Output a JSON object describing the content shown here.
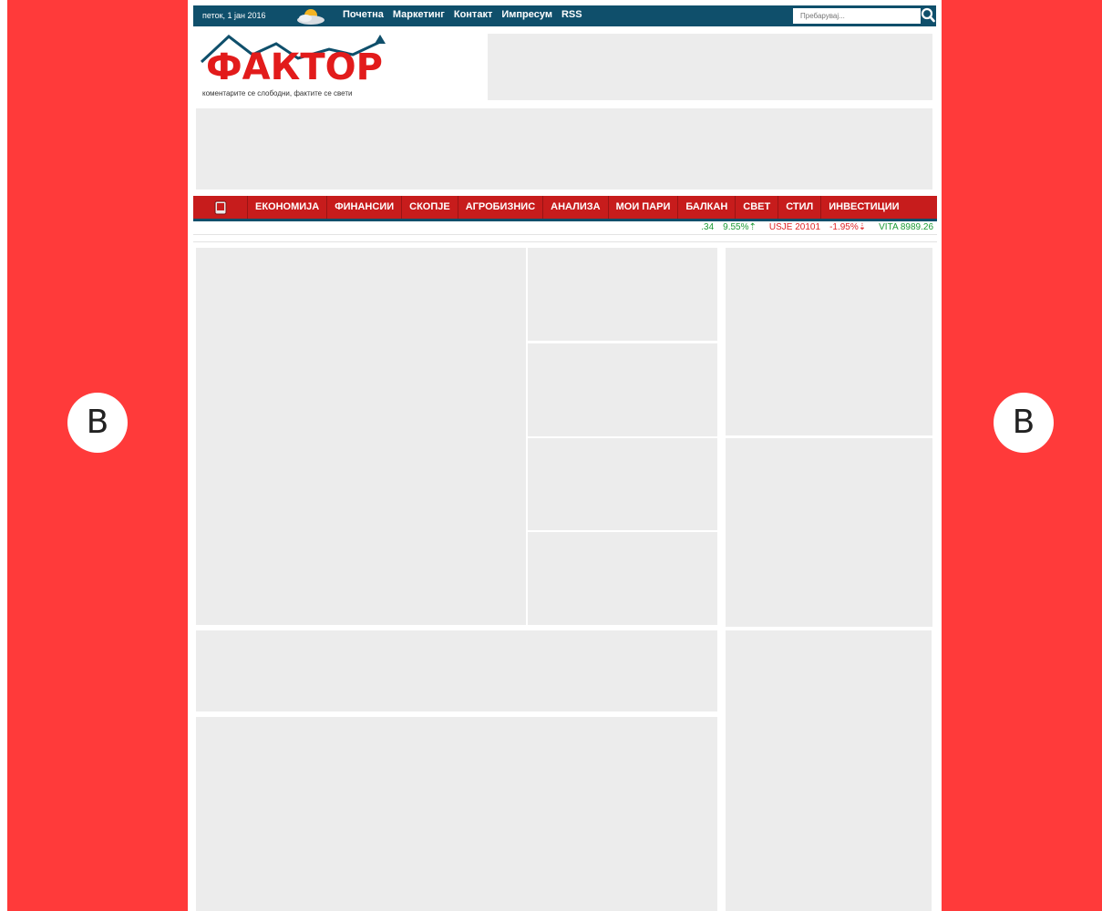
{
  "side_ads": {
    "color": "#ff3a3a",
    "left_badge": "B",
    "right_badge": "B"
  },
  "topbar": {
    "background": "#0f4f6b",
    "date": "петок, 1 јан 2016",
    "weather_icon": "partly-cloudy-icon",
    "nav": [
      "Почетна",
      "Маркетинг",
      "Контакт",
      "Импресум",
      "RSS"
    ],
    "search_placeholder": "Пребарувај...",
    "search_icon": "search-icon"
  },
  "logo": {
    "title": "ФАКТОР",
    "tagline": "коментарите се слободни, фактите се свети",
    "accent": "#e21b1b"
  },
  "categories": {
    "background": "#c71c1c",
    "home_icon": "phone-icon",
    "items": [
      "ЕКОНОМИЈА",
      "ФИНАНСИИ",
      "СКОПЈЕ",
      "АГРОБИЗНИС",
      "АНАЛИЗА",
      "МОИ ПАРИ",
      "БАЛКАН",
      "СВЕТ",
      "СТИЛ",
      "ИНВЕСТИЦИИ"
    ]
  },
  "ticker": {
    "up_color": "#1c9b35",
    "down_color": "#e02424",
    "items": [
      {
        "label": ".34",
        "change": "9.55%",
        "direction": "up"
      },
      {
        "label": "USJE 20101",
        "change": "-1.95%",
        "direction": "down"
      },
      {
        "label": "VITA 8989.26",
        "change": "",
        "direction": "up"
      }
    ]
  }
}
